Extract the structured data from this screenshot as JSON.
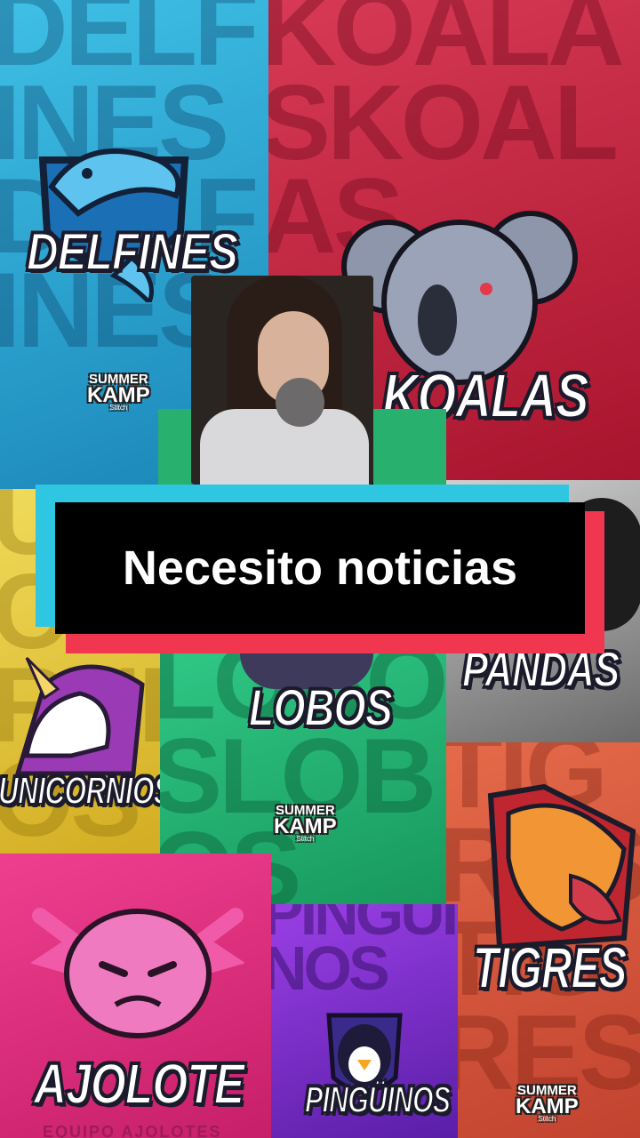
{
  "caption": {
    "text": "Necesito noticias"
  },
  "tiles": {
    "delfines": {
      "name": "DELFINES",
      "bgword": "DELFINESDELFINES",
      "color": "#2aa8d6"
    },
    "koalas": {
      "name": "KOALAS",
      "bgword": "KOALASKOALAS",
      "color": "#c9203e"
    },
    "unicornios": {
      "name": "UNICORNIOS",
      "bgword": "UNICORNIOS",
      "color": "#e6c734"
    },
    "lobos": {
      "name": "LOBOS",
      "bgword": "LOBOSLOBOS",
      "color": "#1fa86a"
    },
    "pandas": {
      "name": "PANDAS",
      "bgword": "PANDAS",
      "color": "#6d6d6d"
    },
    "ajolote": {
      "name": "AJOLOTE",
      "sub": "EQUIPO AJOLOTES",
      "color": "#e0317f"
    },
    "pinguinos": {
      "name": "PINGÜINOS",
      "bgword": "PINGUINOS",
      "color": "#7a2bd0"
    },
    "tigres": {
      "name": "TIGRES",
      "bgword": "TIGRESTIGRES",
      "color": "#d8583d"
    }
  },
  "brand": {
    "line1": "SUMMER",
    "line2": "KAMP",
    "line3": "Stitch"
  }
}
